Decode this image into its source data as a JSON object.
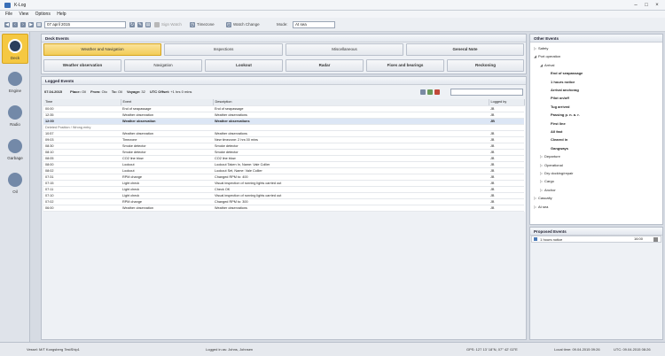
{
  "app": {
    "title": "K-Log"
  },
  "menu": [
    "File",
    "View",
    "Options",
    "Help"
  ],
  "toolbar": {
    "date": "07 april 2015",
    "sign_watch": "Sign Watch",
    "timezone": "Timezone",
    "watch_change": "Watch Change",
    "mode_label": "Mode:",
    "mode_value": "At sea"
  },
  "nav": [
    {
      "label": "Deck",
      "icon": "compass-icon"
    },
    {
      "label": "Engine",
      "icon": "engine-icon"
    },
    {
      "label": "Radio",
      "icon": "antenna-icon"
    },
    {
      "label": "Garbage",
      "icon": "bin-icon"
    },
    {
      "label": "Oil",
      "icon": "oil-drop-icon"
    }
  ],
  "deck": {
    "title": "Deck Events",
    "row1": [
      "Weather and Navigation",
      "Inspections",
      "Miscellaneous",
      "General Note"
    ],
    "row2": [
      "Weather observation",
      "Navigation",
      "Lookout",
      "Radar",
      "Fixes and bearings",
      "Reckoning"
    ]
  },
  "logged": {
    "title": "Logged Events",
    "date": "07.04.2015",
    "place_label": "Place:",
    "place_value": "Oil",
    "from_label": "From:",
    "from_value": "Oio",
    "to_label": "To:",
    "to_value": "Oil",
    "voyage_label": "Voyage:",
    "voyage_value": "32",
    "utc_label": "UTC Offset:",
    "utc_value": "+1 hrs 0 mins",
    "columns": [
      "Time",
      "Event",
      "Description",
      "Logged by"
    ],
    "rows": [
      {
        "time": "00:00",
        "event": "End of seapassage",
        "desc": "End of seapassage",
        "by": "JB"
      },
      {
        "time": "12:35",
        "event": "Weather observation",
        "desc": "Weather observations",
        "by": "JB"
      },
      {
        "time": "12:00",
        "event": "Weather observation",
        "desc": "Weather observations",
        "by": "JB"
      },
      {
        "time": "Deleted Position / Wrong entry",
        "event": "",
        "desc": "",
        "by": ""
      },
      {
        "time": "10:57",
        "event": "Weather observation",
        "desc": "Weather observations",
        "by": "JB"
      },
      {
        "time": "09:03",
        "event": "Timezone",
        "desc": "New timezone: 2 hrs 00 mins",
        "by": "JB"
      },
      {
        "time": "08:30",
        "event": "Smoke detector",
        "desc": "Smoke detector",
        "by": "JB"
      },
      {
        "time": "08:10",
        "event": "Smoke detector",
        "desc": "Smoke detector",
        "by": "JB"
      },
      {
        "time": "08:05",
        "event": "CO2 line blow",
        "desc": "CO2 line blow",
        "by": "JB"
      },
      {
        "time": "08:00",
        "event": "Lookout",
        "desc": "Lookout Taken In, Name: Vale Collier",
        "by": "JB"
      },
      {
        "time": "08:02",
        "event": "Lookout",
        "desc": "Lookout Set, Name: Vale Collier",
        "by": "JB"
      },
      {
        "time": "07:31",
        "event": "RPM change",
        "desc": "Changed RPM to: 400",
        "by": "JB"
      },
      {
        "time": "07:15",
        "event": "Light check",
        "desc": "Visual inspection of running lights carried out",
        "by": "JB"
      },
      {
        "time": "07:11",
        "event": "Light check",
        "desc": "Check OK",
        "by": "JB"
      },
      {
        "time": "07:10",
        "event": "Light check",
        "desc": "Visual inspection of running lights carried out",
        "by": "JB"
      },
      {
        "time": "07:02",
        "event": "RPM change",
        "desc": "Changed RPM to: 300",
        "by": "JB"
      },
      {
        "time": "06:00",
        "event": "Weather observation",
        "desc": "Weather observations",
        "by": "JB"
      }
    ]
  },
  "other": {
    "title": "Other Events",
    "tree": [
      {
        "label": "Safety",
        "level": 0,
        "bold": false,
        "tri": "▷"
      },
      {
        "label": "Port operation",
        "level": 0,
        "bold": false,
        "tri": "◢"
      },
      {
        "label": "Arrival",
        "level": 1,
        "bold": false,
        "tri": "◢"
      },
      {
        "label": "End of seapassage",
        "level": 2,
        "bold": true,
        "tri": ""
      },
      {
        "label": "1 hours notice",
        "level": 2,
        "bold": true,
        "tri": ""
      },
      {
        "label": "Arrival anchorag",
        "level": 2,
        "bold": true,
        "tri": ""
      },
      {
        "label": "Pilot on/off",
        "level": 2,
        "bold": true,
        "tri": ""
      },
      {
        "label": "Tug arrived",
        "level": 2,
        "bold": true,
        "tri": ""
      },
      {
        "label": "Passing p. n. a. r.",
        "level": 2,
        "bold": true,
        "tri": ""
      },
      {
        "label": "First line",
        "level": 2,
        "bold": true,
        "tri": ""
      },
      {
        "label": "All fast",
        "level": 2,
        "bold": true,
        "tri": ""
      },
      {
        "label": "Cleared in",
        "level": 2,
        "bold": true,
        "tri": ""
      },
      {
        "label": "Gangways",
        "level": 2,
        "bold": true,
        "tri": ""
      },
      {
        "label": "Departure",
        "level": 1,
        "bold": false,
        "tri": "▷"
      },
      {
        "label": "Operational",
        "level": 1,
        "bold": false,
        "tri": "▷"
      },
      {
        "label": "Dry docking/repair",
        "level": 1,
        "bold": false,
        "tri": "▷"
      },
      {
        "label": "Cargo",
        "level": 1,
        "bold": false,
        "tri": "▷"
      },
      {
        "label": "Anchor",
        "level": 1,
        "bold": false,
        "tri": "▷"
      },
      {
        "label": "Casualty",
        "level": 0,
        "bold": false,
        "tri": "▷"
      },
      {
        "label": "At sea",
        "level": 0,
        "bold": false,
        "tri": "▷"
      }
    ]
  },
  "proposed": {
    "title": "Proposed Events",
    "item": "1 hours notice",
    "time": "16:00"
  },
  "status": {
    "vessel": "Vessel: M/T Kongsberg TestShip1",
    "logged_in": "Logged in as: Johns, Johnsen",
    "gps": "GPS: 127 13' 18\"N, 07° 42' 02\"E",
    "local": "Local time: 09.04.2015 09:26",
    "utc": "UTC: 09.04.2015 08:26"
  }
}
